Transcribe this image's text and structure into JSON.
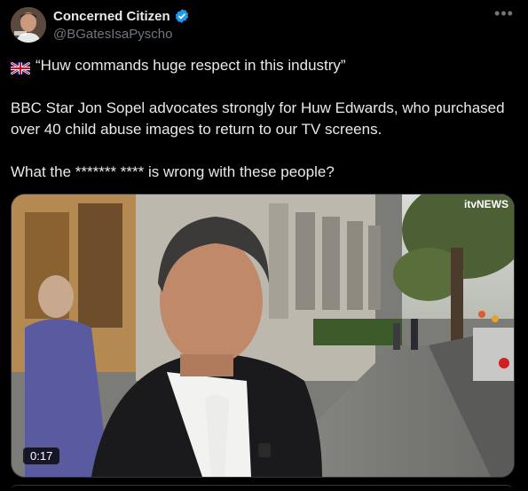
{
  "user": {
    "display_name": "Concerned Citizen",
    "handle": "@BGatesIsaPyscho",
    "verified": true,
    "avatar_icon": "avatar-photo"
  },
  "more_icon": "more-options-icon",
  "tweet": {
    "quote": "“Huw commands huge respect in this industry”",
    "flag_icon": "uk-flag-icon",
    "paragraph": "BBC Star Jon Sopel advocates strongly for Huw Edwards, who purchased over 40 child abuse images to return to our TV screens.",
    "question": "What the ******* **** is wrong with these people?"
  },
  "media": {
    "watermark": "itvNEWS",
    "duration": "0:17"
  },
  "colors": {
    "background": "#000000",
    "text": "#e7e9ea",
    "secondary": "#71767b",
    "verified": "#1d9bf0",
    "border": "#2f3336"
  }
}
